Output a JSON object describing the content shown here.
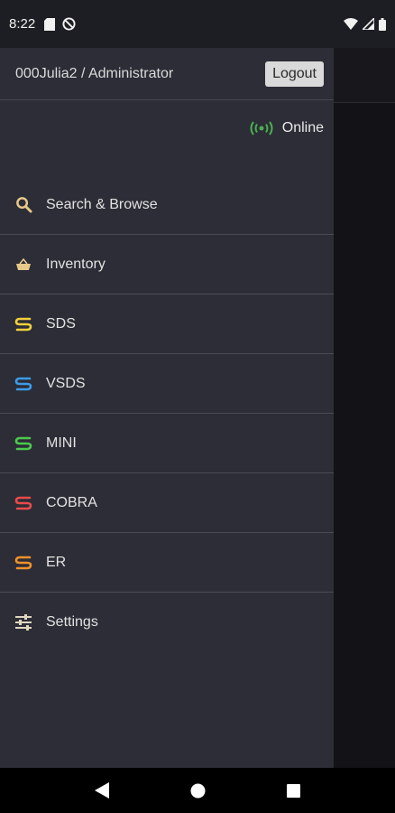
{
  "status_bar": {
    "time": "8:22",
    "left_icons": [
      "sd-card-icon",
      "do-not-disturb-icon"
    ],
    "right_icons": [
      "wifi-icon",
      "cell-signal-icon",
      "battery-icon"
    ]
  },
  "drawer": {
    "user_label": "000Julia2 / Administrator",
    "logout_label": "Logout",
    "connection_status": "Online",
    "connection_color": "#4caf50",
    "menu": [
      {
        "label": "Search & Browse",
        "icon": "search-icon",
        "color": "#e8c98a"
      },
      {
        "label": "Inventory",
        "icon": "basket-icon",
        "color": "#e8c98a"
      },
      {
        "label": "SDS",
        "icon": "s-logo-icon",
        "color": "#f2d03b"
      },
      {
        "label": "VSDS",
        "icon": "s-logo-icon",
        "color": "#3d9be9"
      },
      {
        "label": "MINI",
        "icon": "s-logo-icon",
        "color": "#4cc94c"
      },
      {
        "label": "COBRA",
        "icon": "s-logo-icon",
        "color": "#ea4b4b"
      },
      {
        "label": "ER",
        "icon": "s-logo-icon",
        "color": "#f0922b"
      },
      {
        "label": "Settings",
        "icon": "sliders-icon",
        "color": "#e0d6c0"
      }
    ]
  },
  "nav_bar": [
    "back-icon",
    "home-icon",
    "recents-icon"
  ]
}
